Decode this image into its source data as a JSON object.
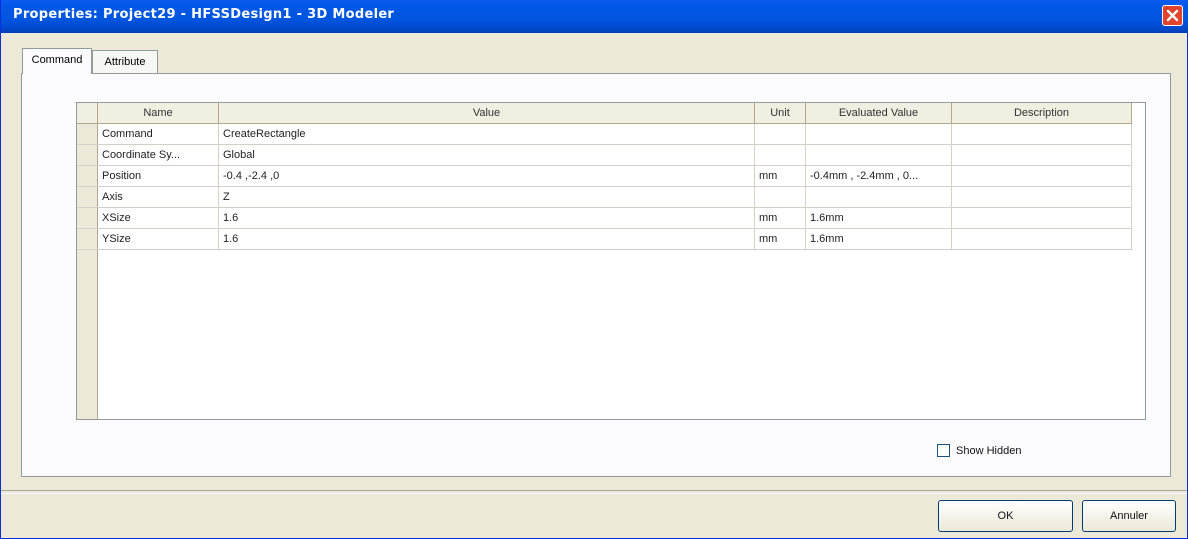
{
  "window": {
    "title": "Properties: Project29 - HFSSDesign1 - 3D Modeler",
    "close_icon": "close-icon"
  },
  "tabs": [
    {
      "label": "Command",
      "active": true
    },
    {
      "label": "Attribute",
      "active": false
    }
  ],
  "table": {
    "columns": [
      "",
      "Name",
      "Value",
      "Unit",
      "Evaluated Value",
      "Description"
    ],
    "rows": [
      {
        "name": "Command",
        "value": "CreateRectangle",
        "unit": "",
        "evaluated": "",
        "description": ""
      },
      {
        "name": "Coordinate Sy...",
        "value": "Global",
        "unit": "",
        "evaluated": "",
        "description": ""
      },
      {
        "name": "Position",
        "value": "-0.4 ,-2.4 ,0",
        "unit": "mm",
        "evaluated": "-0.4mm , -2.4mm , 0...",
        "description": ""
      },
      {
        "name": "Axis",
        "value": "Z",
        "unit": "",
        "evaluated": "",
        "description": ""
      },
      {
        "name": "XSize",
        "value": "1.6",
        "unit": "mm",
        "evaluated": "1.6mm",
        "description": ""
      },
      {
        "name": "YSize",
        "value": "1.6",
        "unit": "mm",
        "evaluated": "1.6mm",
        "description": ""
      }
    ]
  },
  "show_hidden": {
    "label": "Show Hidden",
    "checked": false
  },
  "buttons": {
    "ok": "OK",
    "cancel": "Annuler"
  }
}
